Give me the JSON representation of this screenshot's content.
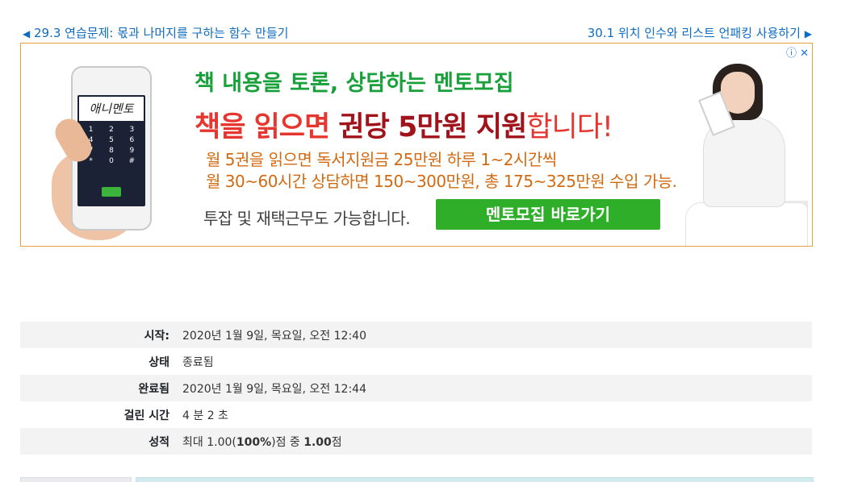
{
  "nav": {
    "prev_arrow": "◀",
    "prev_label": "29.3 연습문제: 몫과 나머지를 구하는 함수 만들기",
    "next_label": "30.1 위치 인수와 리스트 언패킹 사용하기",
    "next_arrow": "▶"
  },
  "ad": {
    "close_text": "ⓘ ✕",
    "phone_logo": "애니멘토",
    "keypad": [
      "1",
      "2",
      "3",
      "4",
      "5",
      "6",
      "7",
      "8",
      "9",
      "*",
      "0",
      "#"
    ],
    "headline1": "책 내용을 토론, 상담하는 멘토모집",
    "headline2_part1": "책을 읽으면 ",
    "headline2_bold": "권당 5만원 지원",
    "headline2_part2": "합니다!",
    "line3": "월 5권을 읽으면 독서지원금 25만원 하루 1~2시간씩",
    "line4": "월 30~60시간 상담하면 150~300만원, 총 175~325만원 수입 가능.",
    "line5": "투잡 및 재택근무도 가능합니다.",
    "button": "멘토모집 바로가기",
    "colors": {
      "green": "#1aa03a",
      "red": "#e6362f",
      "dark_red": "#a1131a",
      "orange": "#d26a11",
      "button_bg": "#2fae2a",
      "border": "#e8a13c"
    }
  },
  "summary": {
    "rows": [
      {
        "label": "시작:",
        "value": "2020년 1월 9일, 목요일, 오전 12:40"
      },
      {
        "label": "상태",
        "value": "종료됨"
      },
      {
        "label": "완료됨",
        "value": "2020년 1월 9일, 목요일, 오전 12:44"
      },
      {
        "label": "걸린 시간",
        "value": "4 분 2 초"
      },
      {
        "label": "성적",
        "value_prefix": "최대 1.00(",
        "value_bold1": "100%",
        "value_mid": ")점 중 ",
        "value_bold2": "1.00",
        "value_suffix": "점"
      }
    ]
  },
  "colors": {
    "link": "#0f6cbf",
    "row_alt": "#f3f3f3"
  }
}
